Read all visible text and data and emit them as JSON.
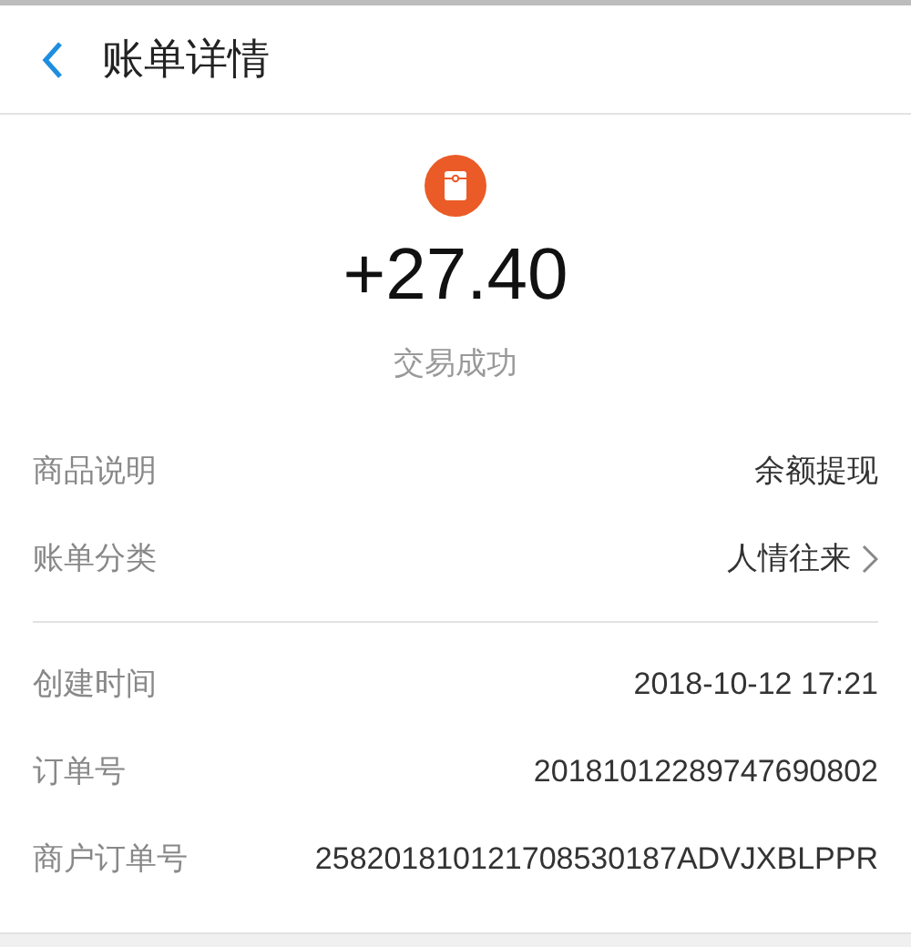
{
  "header": {
    "title": "账单详情"
  },
  "summary": {
    "amount": "+27.40",
    "status": "交易成功"
  },
  "groups": [
    {
      "rows": [
        {
          "label": "商品说明",
          "value": "余额提现",
          "kind": "plain"
        },
        {
          "label": "账单分类",
          "value": "人情往来",
          "kind": "link"
        }
      ]
    },
    {
      "rows": [
        {
          "label": "创建时间",
          "value": "2018-10-12 17:21",
          "kind": "plain"
        },
        {
          "label": "订单号",
          "value": "20181012289747690802",
          "kind": "plain"
        },
        {
          "label": "商户订单号",
          "value": "258201810121708530187ADVJXBLPPR",
          "kind": "plain"
        }
      ]
    }
  ]
}
